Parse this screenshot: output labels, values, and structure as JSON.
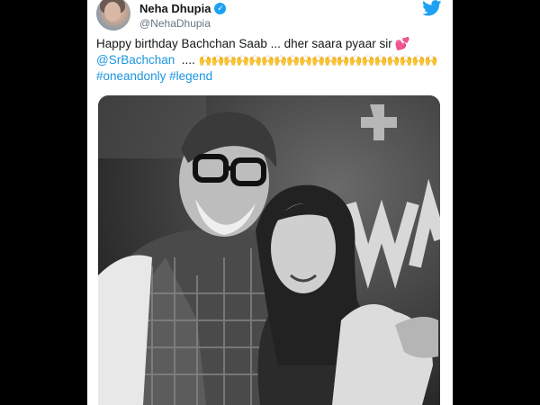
{
  "header": {
    "display_name": "Neha Dhupia",
    "handle": "@NehaDhupia",
    "verified": true
  },
  "tweet": {
    "line1_text": "Happy birthday Bachchan Saab ... dher saara pyaar sir",
    "line2_mention": "@SrBachchan",
    "line2_dots": "....",
    "line3_hashtags": "#oneandonly #legend",
    "emoji_heart": "💕",
    "emoji_hands": "🙌🙌🙌🙌🙌🙌🙌🙌🙌🙌🙌🙌🙌🙌🙌🙌🙌🙌🙌"
  },
  "colors": {
    "brand_blue": "#1da1f2",
    "link_blue": "#1b95e0",
    "text": "#14171a",
    "muted": "#657786"
  },
  "icons": {
    "twitter": "twitter-bird-icon",
    "verified": "verified-badge-icon"
  }
}
